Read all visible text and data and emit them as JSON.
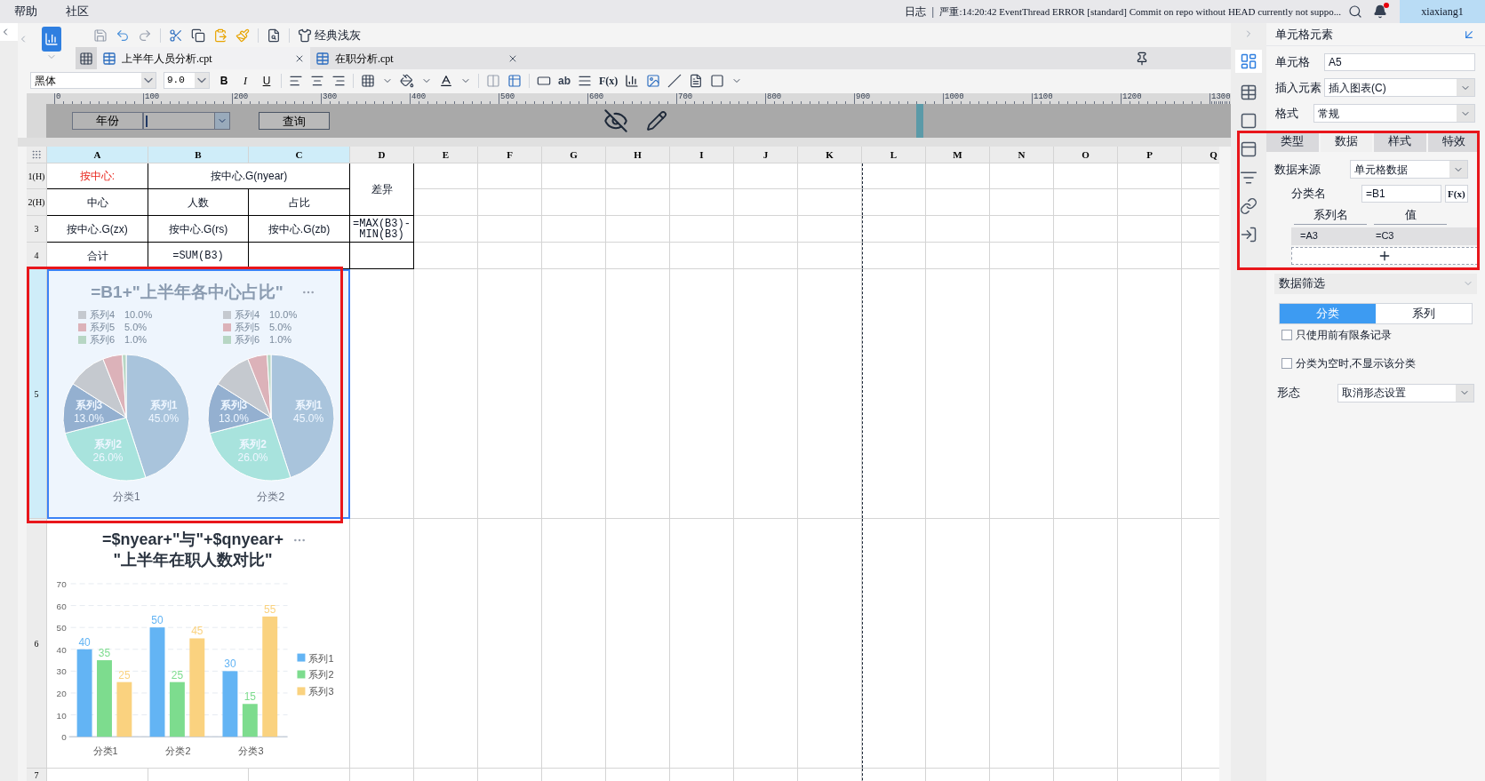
{
  "menu_bar": {
    "items": [
      "帮助",
      "社区"
    ],
    "log_label": "日志",
    "log_separator": "|",
    "log_message": "严重:14:20:42 EventThread ERROR [standard] Commit on repo without HEAD currently not suppo...",
    "user": "xiaxiang1",
    "has_notification": true
  },
  "toolbar": {
    "theme_button": "经典浅灰"
  },
  "tabs": [
    {
      "label": "上半年人员分析.cpt",
      "selected": true
    },
    {
      "label": "在职分析.cpt",
      "selected": false
    }
  ],
  "format_bar": {
    "font": "黑体",
    "size": "9.0",
    "bold": "B",
    "italic": "I",
    "underline": "U",
    "text_tool": "ab",
    "formula_tool": "F(x)"
  },
  "ruler": [
    "0",
    "100",
    "200",
    "300",
    "400",
    "500",
    "600",
    "700",
    "800",
    "900",
    "1000",
    "1100",
    "1200",
    "1300"
  ],
  "parameter_pane": {
    "label": "年份",
    "query_button": "查询"
  },
  "sheet": {
    "columns": [
      {
        "name": "A",
        "selected": true
      },
      {
        "name": "B",
        "selected": true
      },
      {
        "name": "C",
        "selected": true
      },
      {
        "name": "D",
        "selected": false
      },
      {
        "name": "E",
        "selected": false
      },
      {
        "name": "F",
        "selected": false
      },
      {
        "name": "G",
        "selected": false
      },
      {
        "name": "H",
        "selected": false
      },
      {
        "name": "I",
        "selected": false
      },
      {
        "name": "J",
        "selected": false
      },
      {
        "name": "K",
        "selected": false
      },
      {
        "name": "L",
        "selected": false
      },
      {
        "name": "M",
        "selected": false
      },
      {
        "name": "N",
        "selected": false
      },
      {
        "name": "O",
        "selected": false
      },
      {
        "name": "P",
        "selected": false
      },
      {
        "name": "Q",
        "selected": false
      }
    ],
    "rows": [
      {
        "name": "1(H)",
        "selected": false
      },
      {
        "name": "2(H)",
        "selected": false
      },
      {
        "name": "3",
        "selected": false
      },
      {
        "name": "4",
        "selected": false
      },
      {
        "name": "5",
        "selected": true
      },
      {
        "name": "6",
        "selected": false
      },
      {
        "name": "7",
        "selected": false
      }
    ],
    "cells": [
      {
        "text": "按中心:",
        "kind": "label"
      },
      {
        "text": "按中心.G(nyear)",
        "kind": "text"
      },
      {
        "text": "差异",
        "kind": "text"
      },
      {
        "text": "中心",
        "kind": "text"
      },
      {
        "text": "人数",
        "kind": "text"
      },
      {
        "text": "占比",
        "kind": "text"
      },
      {
        "text": "按中心.G(zx)",
        "kind": "text"
      },
      {
        "text": "按中心.G(rs)",
        "kind": "text"
      },
      {
        "text": "按中心.G(zb)",
        "kind": "text"
      },
      {
        "text": "=MAX(B3)-MIN(B3)",
        "kind": "formula"
      },
      {
        "text": "合计",
        "kind": "text"
      },
      {
        "text": "=SUM(B3)",
        "kind": "formula"
      }
    ]
  },
  "pie_chart": {
    "title": "=B1+\"上半年各中心占比\"",
    "pies": [
      {
        "caption": "分类1",
        "chart_data": {
          "type": "pie",
          "legend": true,
          "categories": [
            "系列1",
            "系列2",
            "系列3",
            "系列4",
            "系列5",
            "系列6"
          ],
          "values": [
            45,
            26,
            13,
            10,
            5,
            1
          ],
          "colors": [
            "#a9c4dc",
            "#a8e3dd",
            "#94b0d0",
            "#c5c9cf",
            "#dcb2b9",
            "#b7d6c4"
          ],
          "value_labels": [
            "45.0%",
            "26.0%",
            "13.0%",
            "10.0%",
            "5.0%",
            "1.0%"
          ]
        }
      },
      {
        "caption": "分类2",
        "chart_data": {
          "type": "pie",
          "legend": true,
          "categories": [
            "系列1",
            "系列2",
            "系列3",
            "系列4",
            "系列5",
            "系列6"
          ],
          "values": [
            45,
            26,
            13,
            10,
            5,
            1
          ],
          "colors": [
            "#a9c4dc",
            "#a8e3dd",
            "#94b0d0",
            "#c5c9cf",
            "#dcb2b9",
            "#b7d6c4"
          ],
          "value_labels": [
            "45.0%",
            "26.0%",
            "13.0%",
            "10.0%",
            "5.0%",
            "1.0%"
          ]
        }
      }
    ]
  },
  "bar_chart": {
    "title_lines": [
      "=$nyear+\"与\"+$qnyear+",
      "\"上半年在职人数对比\""
    ],
    "chart_data": {
      "type": "bar",
      "categories": [
        "分类1",
        "分类2",
        "分类3"
      ],
      "series": [
        {
          "name": "系列1",
          "color": "#63b4f4",
          "values": [
            40,
            50,
            30
          ]
        },
        {
          "name": "系列2",
          "color": "#7ddc8e",
          "values": [
            35,
            25,
            15
          ]
        },
        {
          "name": "系列3",
          "color": "#fad27f",
          "values": [
            25,
            45,
            55
          ]
        }
      ],
      "ylim": [
        0,
        70
      ],
      "yticks": [
        0,
        10,
        20,
        30,
        40,
        50,
        60,
        70
      ],
      "data_labels": true,
      "grid": true,
      "legend": true
    }
  },
  "right_panel": {
    "title": "单元格元素",
    "cell_label": "单元格",
    "cell_value": "A5",
    "insert_label": "插入元素",
    "insert_value": "插入图表(C)",
    "format_label": "格式",
    "format_value": "常规",
    "tabs": [
      {
        "label": "类型",
        "selected": false
      },
      {
        "label": "数据",
        "selected": true
      },
      {
        "label": "样式",
        "selected": false
      },
      {
        "label": "特效",
        "selected": false
      }
    ],
    "source_label": "数据来源",
    "source_value": "单元格数据",
    "category_label": "分类名",
    "category_value": "=B1",
    "formula_button": "F(x)",
    "series_header": [
      "系列名",
      "值"
    ],
    "series_rows": [
      {
        "name": "=A3",
        "value": "=C3"
      }
    ],
    "filter_title": "数据筛选",
    "filter_toggle": [
      {
        "label": "分类",
        "selected": true
      },
      {
        "label": "系列",
        "selected": false
      }
    ],
    "options": [
      {
        "label": "只使用前有限条记录",
        "checked": false
      },
      {
        "label": "分类为空时,不显示该分类",
        "checked": false
      }
    ],
    "shape_label": "形态",
    "shape_value": "取消形态设置"
  }
}
